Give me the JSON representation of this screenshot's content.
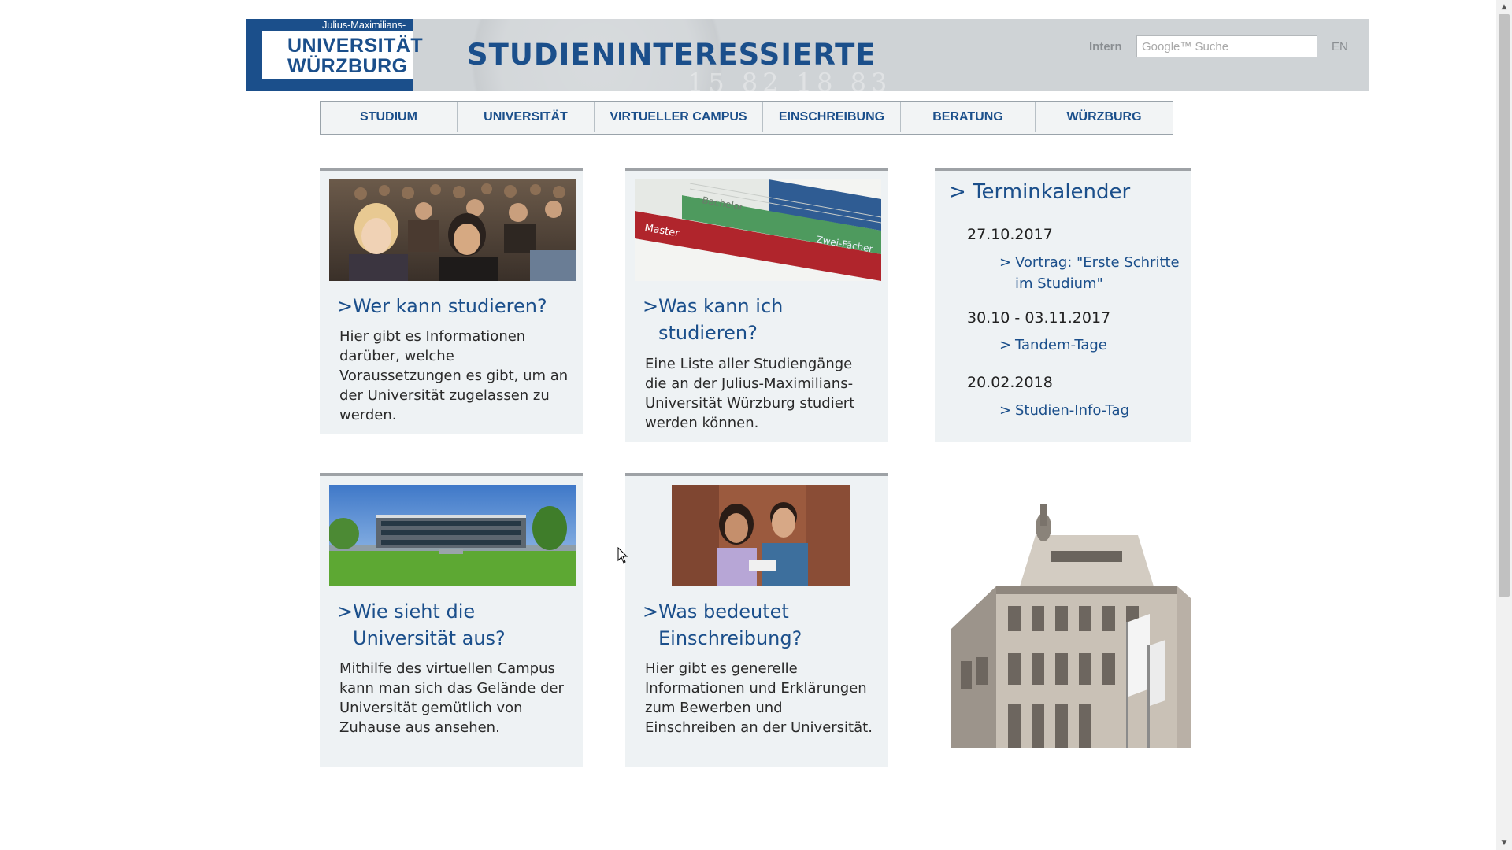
{
  "header": {
    "logo_top": "Julius-Maximilians-",
    "logo_line1": "UNIVERSITÄT",
    "logo_line2": "WÜRZBURG",
    "seal_text": "15  82  18  83",
    "title": "STUDIENINTERESSIERTE",
    "intern_label": "Intern",
    "search_placeholder": "Google™ Suche",
    "lang_label": "EN"
  },
  "nav": {
    "items": [
      {
        "label": "STUDIUM"
      },
      {
        "label": "UNIVERSITÄT"
      },
      {
        "label": "VIRTUELLER CAMPUS"
      },
      {
        "label": "EINSCHREIBUNG"
      },
      {
        "label": "BERATUNG"
      },
      {
        "label": "WÜRZBURG"
      }
    ]
  },
  "boxes": [
    {
      "heading_prefix": ">",
      "heading": "Wer kann studieren?",
      "text": "Hier gibt es Informationen darüber, welche Voraussetzungen es gibt, um an der Universität zugelassen zu werden.",
      "image": "lecture-hall-students-photo"
    },
    {
      "heading_prefix": ">",
      "heading": "Was kann ich studieren?",
      "text": "Eine Liste aller Studiengänge die an der Julius-Maximilians-Universität Würzburg studiert werden können.",
      "image": "study-programs-brochure-photo",
      "image_text": [
        "Master",
        "Bachelor",
        "Zwei-Fächer"
      ]
    },
    {
      "heading_prefix": ">",
      "heading": "Wie sieht die Universität aus?",
      "text": "Mithilfe des virtuellen Campus kann man sich das Gelände der Universität gemütlich von Zuhause aus ansehen.",
      "image": "campus-building-photo"
    },
    {
      "heading_prefix": ">",
      "heading": "Was bedeutet Einschreibung?",
      "text": "Hier gibt es generelle Informationen und Erklärungen zum Bewerben und Einschreiben an der Universität.",
      "image": "two-students-photo"
    }
  ],
  "calendar": {
    "title_prefix": ">",
    "title": "Terminkalender",
    "entries": [
      {
        "date": "27.10.2017",
        "event_prefix": ">",
        "event": "Vortrag: \"Erste Schritte im Studium\""
      },
      {
        "date": "30.10 - 03.11.2017",
        "event_prefix": ">",
        "event": "Tandem-Tage"
      },
      {
        "date": "20.02.2018",
        "event_prefix": ">",
        "event": "Studien-Info-Tag"
      }
    ]
  },
  "building_image": "university-main-building-photo",
  "icons": {
    "scroll_up": "▲",
    "scroll_down": "▼",
    "cursor": "mouse-pointer-icon"
  },
  "colors": {
    "brand_blue": "#1b4f8b",
    "header_gray": "#cfd3d6",
    "box_bg": "#eef2f4",
    "box_border": "#9ea2a6"
  }
}
